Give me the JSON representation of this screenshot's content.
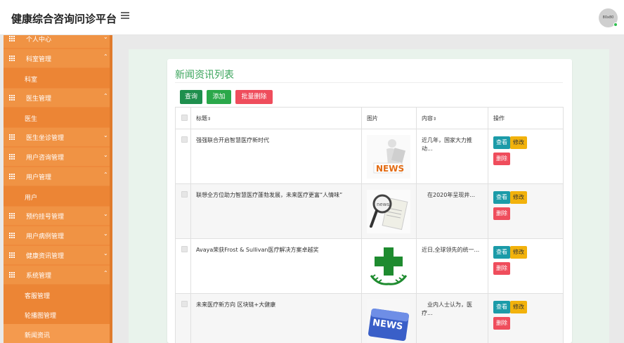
{
  "app": {
    "title": "健康综合咨询问诊平台",
    "avatar_text": "80x80"
  },
  "sidebar": {
    "items": [
      {
        "label": "个人中心",
        "chevron": "⌄"
      },
      {
        "label": "科室管理",
        "chevron": "⌃"
      },
      {
        "label": "科室",
        "sub": true
      },
      {
        "label": "医生管理",
        "chevron": "⌃"
      },
      {
        "label": "医生",
        "sub": true
      },
      {
        "label": "医生坐诊管理",
        "chevron": "⌄"
      },
      {
        "label": "用户咨询管理",
        "chevron": "⌄"
      },
      {
        "label": "用户管理",
        "chevron": "⌃"
      },
      {
        "label": "用户",
        "sub": true
      },
      {
        "label": "预约挂号管理",
        "chevron": "⌄"
      },
      {
        "label": "用户病例管理",
        "chevron": "⌄"
      },
      {
        "label": "健康资讯管理",
        "chevron": "⌄"
      },
      {
        "label": "系统管理",
        "chevron": "⌃"
      },
      {
        "label": "客服管理",
        "sub": true
      },
      {
        "label": "轮播图管理",
        "sub": true
      },
      {
        "label": "新闻资讯",
        "sub": true
      }
    ]
  },
  "card": {
    "title": "新闻资讯列表"
  },
  "toolbar": {
    "query": "查询",
    "add": "添加",
    "batch_delete": "批量删除"
  },
  "table": {
    "headers": {
      "title": "标题",
      "image": "图片",
      "content": "内容",
      "actions": "操作",
      "sort_icon": "⇕"
    },
    "rows": [
      {
        "title": "强强联合开启智慧医疗新时代",
        "content": "近几年，国家大力推动...",
        "image": "news-person-thumbnail"
      },
      {
        "title": "联想全方位助力智慧医疗蓬勃发展，未来医疗更富“人情味”",
        "content": "　在2020年呈现井...",
        "image": "magnifier-news-thumbnail"
      },
      {
        "title": "Avaya荣获Frost & Sullivan医疗解决方案卓越奖",
        "content": "近日,全球领先的统一...",
        "image": "green-cross-thumbnail"
      },
      {
        "title": "未来医疗新方向 区块链+大健康",
        "content": "　业内人士认为，医疗...",
        "image": "news-key-thumbnail"
      }
    ],
    "actions": {
      "view": "查看",
      "edit": "修改",
      "delete": "删除"
    }
  },
  "colors": {
    "sidebar": "#ee8a3c",
    "accent_green": "#3aa45b",
    "query_btn": "#1e8f4d",
    "add_btn": "#2aa84a",
    "danger": "#ef4d5c",
    "warning": "#f2b20c",
    "info": "#1b9ba8"
  }
}
